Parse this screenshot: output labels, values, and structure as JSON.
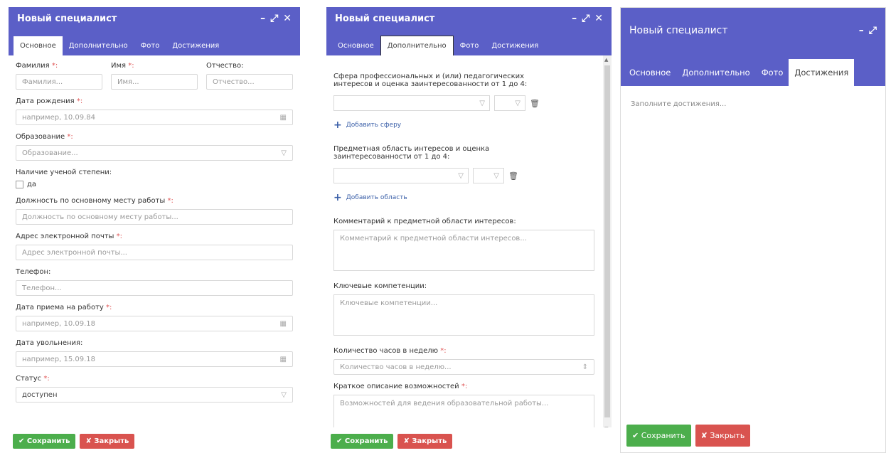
{
  "dialog1": {
    "title": "Новый специалист",
    "controls": {
      "minimize": "–",
      "maximize": "⤢",
      "close": "✕"
    },
    "tabs": [
      "Основное",
      "Дополнительно",
      "Фото",
      "Достижения"
    ],
    "fields": {
      "last_name": {
        "label": "Фамилия",
        "required": "*:",
        "placeholder": "Фамилия..."
      },
      "first_name": {
        "label": "Имя",
        "required": "*:",
        "placeholder": "Имя..."
      },
      "patronymic": {
        "label": "Отчество:",
        "placeholder": "Отчество..."
      },
      "birth_date": {
        "label": "Дата рождения",
        "required": "*:",
        "placeholder": "например, 10.09.84"
      },
      "education": {
        "label": "Образование",
        "required": "*:",
        "placeholder": "Образование..."
      },
      "degree": {
        "label": "Наличие ученой степени:",
        "checkbox": "да"
      },
      "position": {
        "label": "Должность по основному месту работы",
        "required": "*:",
        "placeholder": "Должность по основному месту работы..."
      },
      "email": {
        "label": "Адрес электронной почты",
        "required": "*:",
        "placeholder": "Адрес электронной почты..."
      },
      "phone": {
        "label": "Телефон:",
        "placeholder": "Телефон..."
      },
      "hire_date": {
        "label": "Дата приема на работу",
        "required": "*:",
        "placeholder": "например, 10.09.18"
      },
      "dismissal_date": {
        "label": "Дата увольнения:",
        "placeholder": "например, 15.09.18"
      },
      "status": {
        "label": "Статус",
        "required": "*:",
        "value": "доступен"
      }
    },
    "save_label": "Сохранить",
    "close_label": "Закрыть"
  },
  "dialog2": {
    "title": "Новый специалист",
    "controls": {
      "minimize": "–",
      "maximize": "⤢",
      "close": "✕"
    },
    "tabs": [
      "Основное",
      "Дополнительно",
      "Фото",
      "Достижения"
    ],
    "fields": {
      "sphere_label_1": "Сфера профессиональных и (или) педагогических",
      "sphere_label_2": "интересов и оценка заинтересованности от 1 до 4:",
      "add_sphere": "Добавить сферу",
      "subject_label_1": "Предметная область интересов и оценка",
      "subject_label_2": "заинтересованности от 1 до 4:",
      "add_subject": "Добавить область",
      "comment": {
        "label": "Комментарий к предметной области интересов:",
        "placeholder": "Комментарий к предметной области интересов..."
      },
      "competencies": {
        "label": "Ключевые компетенции:",
        "placeholder": "Ключевые компетенции..."
      },
      "hours": {
        "label": "Количество часов в неделю",
        "required": "*:",
        "placeholder": "Количество часов в неделю..."
      },
      "capabilities": {
        "label": "Краткое описание возможностей",
        "required": "*:",
        "placeholder": "Возможностей для ведения образовательной работы..."
      }
    },
    "save_label": "Сохранить",
    "close_label": "Закрыть"
  },
  "dialog3": {
    "title": "Новый специалист",
    "controls": {
      "minimize": "–",
      "maximize": "⤢",
      "close": "✕"
    },
    "tabs": [
      "Основное",
      "Дополнительно",
      "Фото",
      "Достижения"
    ],
    "achievements_placeholder": "Заполните достижения...",
    "save_label": "Сохранить",
    "close_label": "Закрыть"
  },
  "icons": {
    "check": "✔",
    "cross": "✘",
    "calendar": "▦",
    "caret": "▽",
    "spinner": "⇕",
    "trash": "🗑",
    "plus": "+"
  }
}
